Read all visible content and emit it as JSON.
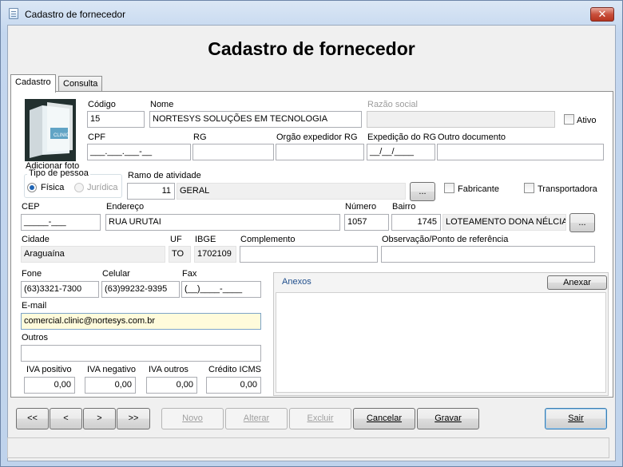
{
  "window": {
    "title": "Cadastro de fornecedor",
    "close_label": "✕"
  },
  "heading": "Cadastro de fornecedor",
  "tabs": [
    {
      "label": "Cadastro"
    },
    {
      "label": "Consulta"
    }
  ],
  "photo": {
    "caption": "Adicionar foto",
    "box_text": "CLINIC"
  },
  "fields": {
    "codigo": {
      "label": "Código",
      "value": "15"
    },
    "nome": {
      "label": "Nome",
      "value": "NORTESYS SOLUÇÕES EM TECNOLOGIA"
    },
    "razao_social": {
      "label": "Razão social",
      "value": ""
    },
    "ativo": {
      "label": "Ativo",
      "checked": false
    },
    "cpf": {
      "label": "CPF",
      "value": "___.___.___-__"
    },
    "rg": {
      "label": "RG",
      "value": ""
    },
    "orgao_expedidor": {
      "label": "Orgão expedidor RG",
      "value": ""
    },
    "expedicao_rg": {
      "label": "Expedição do RG",
      "value": "__/__/____"
    },
    "outro_documento": {
      "label": "Outro documento",
      "value": ""
    },
    "tipo_pessoa": {
      "legend": "Tipo de pessoa",
      "fisica": "Física",
      "juridica": "Jurídica",
      "selected": "Física"
    },
    "ramo_atividade": {
      "label": "Ramo de atividade",
      "code": "11",
      "desc": "GERAL",
      "lookup": "..."
    },
    "fabricante": {
      "label": "Fabricante",
      "checked": false
    },
    "transportadora": {
      "label": "Transportadora",
      "checked": false
    },
    "cep": {
      "label": "CEP",
      "value": "_____-___"
    },
    "endereco": {
      "label": "Endereço",
      "value": "RUA URUTAI"
    },
    "numero": {
      "label": "Número",
      "value": "1057"
    },
    "bairro": {
      "label": "Bairro",
      "code": "1745",
      "desc": "LOTEAMENTO DONA NÉLCIA",
      "lookup": "..."
    },
    "cidade": {
      "label": "Cidade",
      "value": "Araguaína"
    },
    "uf": {
      "label": "UF",
      "value": "TO"
    },
    "ibge": {
      "label": "IBGE",
      "value": "1702109"
    },
    "complemento": {
      "label": "Complemento",
      "value": ""
    },
    "observacao": {
      "label": "Observação/Ponto de referência",
      "value": ""
    },
    "fone": {
      "label": "Fone",
      "value": "(63)3321-7300"
    },
    "celular": {
      "label": "Celular",
      "value": "(63)99232-9395"
    },
    "fax": {
      "label": "Fax",
      "value": "(__)____-____"
    },
    "email": {
      "label": "E-mail",
      "value": "comercial.clinic@nortesys.com.br"
    },
    "outros": {
      "label": "Outros",
      "value": ""
    },
    "iva_positivo": {
      "label": "IVA positivo",
      "value": "0,00"
    },
    "iva_negativo": {
      "label": "IVA negativo",
      "value": "0,00"
    },
    "iva_outros": {
      "label": "IVA outros",
      "value": "0,00"
    },
    "credito_icms": {
      "label": "Crédito ICMS",
      "value": "0,00"
    }
  },
  "anexos": {
    "title": "Anexos",
    "button": "Anexar"
  },
  "toolbar": {
    "first": "<<",
    "prev": "<",
    "next": ">",
    "last": ">>",
    "novo": "Novo",
    "alterar": "Alterar",
    "excluir": "Excluir",
    "cancelar": "Cancelar",
    "gravar": "Gravar",
    "sair": "Sair"
  },
  "colors": {
    "title_gradient_top": "#dbe7f5",
    "form_bg": "#f0f0f0",
    "email_highlight": "#fffbdb",
    "close_red": "#c9503c"
  }
}
